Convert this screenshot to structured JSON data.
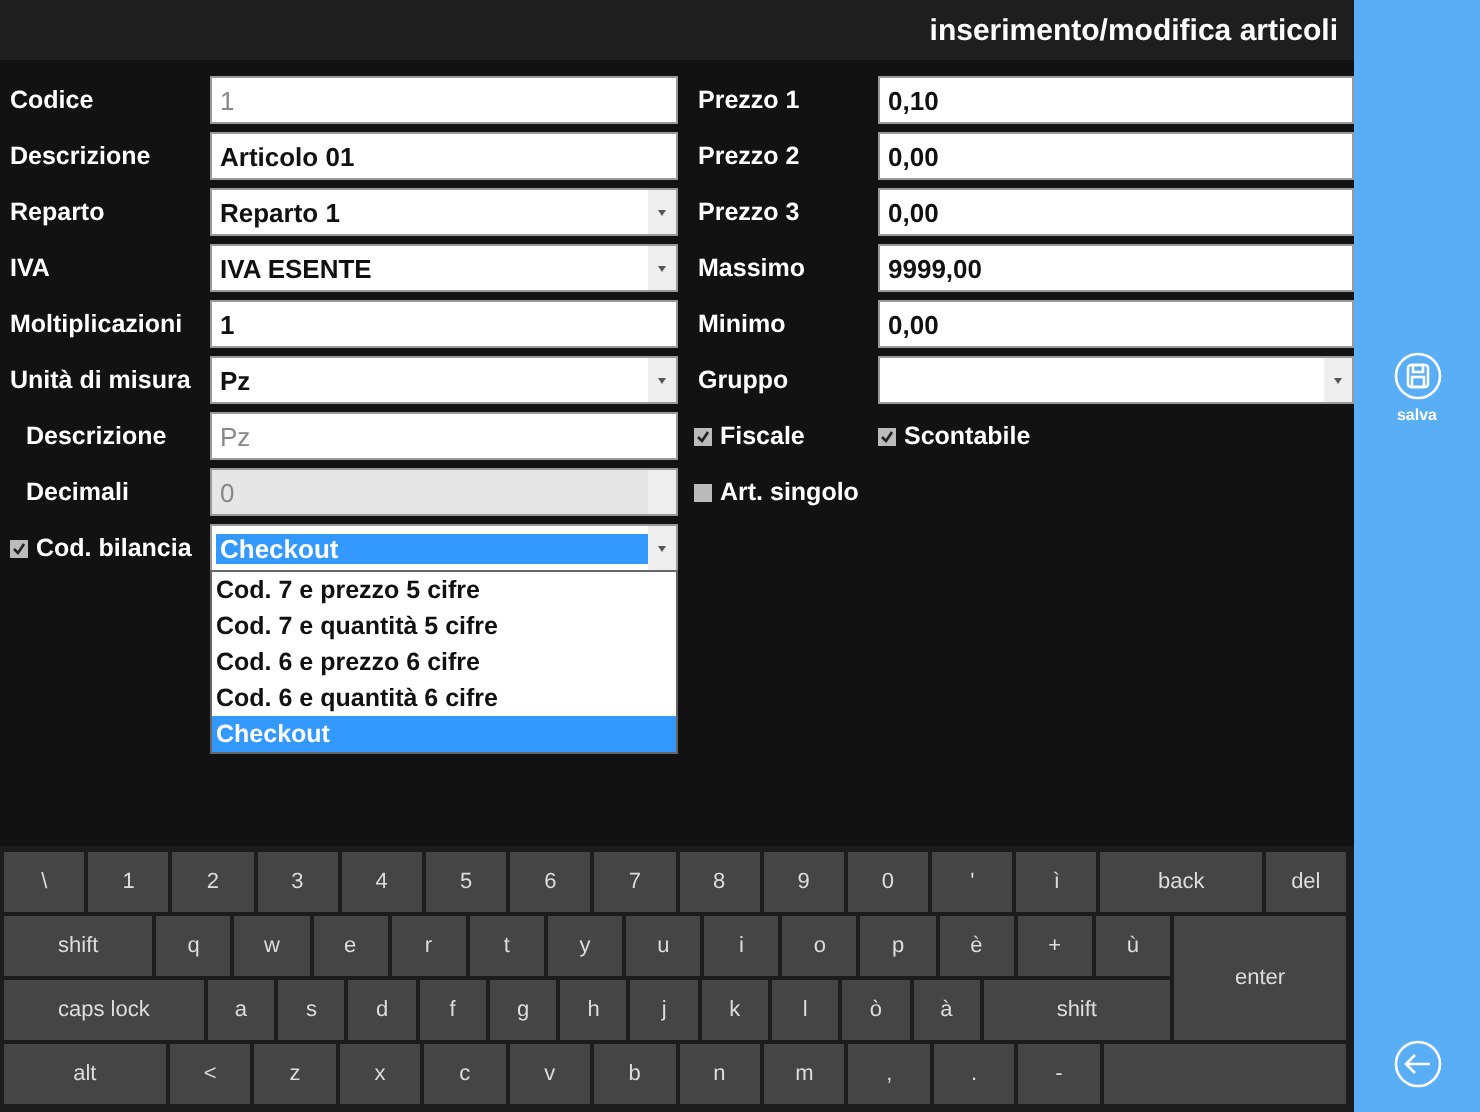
{
  "window": {
    "title": "inserimento/modifica articoli"
  },
  "left_fields": [
    {
      "label": "Codice",
      "kind": "text",
      "value": "1",
      "readonly": true
    },
    {
      "label": "Descrizione",
      "kind": "text",
      "value": "Articolo 01",
      "readonly": false
    },
    {
      "label": "Reparto",
      "kind": "select",
      "value": "Reparto 1",
      "readonly": false
    },
    {
      "label": "IVA",
      "kind": "select",
      "value": "IVA ESENTE",
      "readonly": false
    },
    {
      "label": "Moltiplicazioni",
      "kind": "text",
      "value": "1",
      "readonly": false
    },
    {
      "label": "Unità di misura",
      "kind": "select",
      "value": "Pz",
      "readonly": false,
      "children": [
        {
          "label": "Descrizione",
          "kind": "text",
          "value": "Pz",
          "readonly": true
        },
        {
          "label": "Decimali",
          "kind": "select",
          "value": "0",
          "readonly": true,
          "disabled": true
        }
      ]
    }
  ],
  "cod_bilancia": {
    "label": "Cod. bilancia",
    "checked": true,
    "value": "Checkout",
    "expanded": true,
    "options": [
      {
        "label": "Cod. 7 e prezzo 5 cifre",
        "selected": false
      },
      {
        "label": "Cod. 7 e quantità 5 cifre",
        "selected": false
      },
      {
        "label": "Cod. 6 e prezzo 6 cifre",
        "selected": false
      },
      {
        "label": "Cod. 6 e quantità 6 cifre",
        "selected": false
      },
      {
        "label": "Checkout",
        "selected": true
      }
    ]
  },
  "right_fields": [
    {
      "label": "Prezzo 1",
      "kind": "text",
      "value": "0,10"
    },
    {
      "label": "Prezzo 2",
      "kind": "text",
      "value": "0,00"
    },
    {
      "label": "Prezzo 3",
      "kind": "text",
      "value": "0,00"
    },
    {
      "label": "Massimo",
      "kind": "text",
      "value": "9999,00"
    },
    {
      "label": "Minimo",
      "kind": "text",
      "value": "0,00"
    },
    {
      "label": "Gruppo",
      "kind": "select"
    }
  ],
  "right_checks": [
    {
      "label": "Fiscale",
      "checked": true
    },
    {
      "label": "Scontabile",
      "checked": true
    },
    {
      "label": "Art. singolo",
      "checked": false
    }
  ],
  "keyboard": {
    "key_lines": [
      {
        "keys": [
          "\\",
          "1",
          "2",
          "3",
          "4",
          "5",
          "6",
          "7",
          "8",
          "9",
          "0",
          "'",
          "ì",
          "back",
          "del"
        ]
      },
      {
        "keys": [
          "shift",
          "q",
          "w",
          "e",
          "r",
          "t",
          "y",
          "u",
          "i",
          "o",
          "p",
          "è",
          "+",
          "ù"
        ]
      },
      {
        "keys": [
          "caps lock",
          "a",
          "s",
          "d",
          "f",
          "g",
          "h",
          "j",
          "k",
          "l",
          "ò",
          "à",
          "shift"
        ]
      },
      {
        "keys": [
          "alt",
          "<",
          "z",
          "x",
          "c",
          "v",
          "b",
          "n",
          "m",
          ",",
          ".",
          "-"
        ]
      }
    ],
    "enter": "enter"
  },
  "sidebar": {
    "save_label": "salva"
  }
}
